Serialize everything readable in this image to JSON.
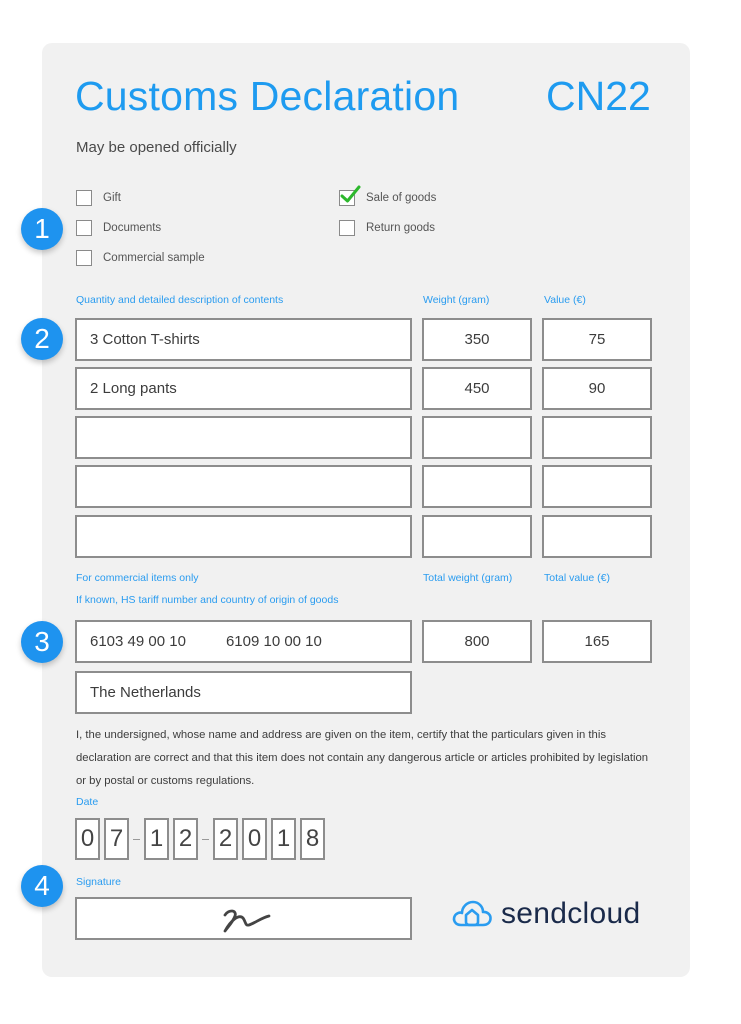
{
  "header": {
    "title": "Customs Declaration",
    "form_code": "CN22",
    "subtitle": "May be opened officially"
  },
  "badges": [
    "1",
    "2",
    "3",
    "4"
  ],
  "categories": {
    "left": [
      {
        "label": "Gift",
        "checked": false
      },
      {
        "label": "Documents",
        "checked": false
      },
      {
        "label": "Commercial sample",
        "checked": false
      }
    ],
    "right": [
      {
        "label": "Sale of goods",
        "checked": true
      },
      {
        "label": "Return goods",
        "checked": false
      }
    ]
  },
  "contents": {
    "headers": {
      "description": "Quantity and detailed description of contents",
      "weight": "Weight (gram)",
      "value": "Value (€)"
    },
    "rows": [
      {
        "description": "3 Cotton T-shirts",
        "weight": "350",
        "value": "75"
      },
      {
        "description": "2 Long pants",
        "weight": "450",
        "value": "90"
      },
      {
        "description": "",
        "weight": "",
        "value": ""
      },
      {
        "description": "",
        "weight": "",
        "value": ""
      },
      {
        "description": "",
        "weight": "",
        "value": ""
      }
    ]
  },
  "commercial": {
    "label_line1": "For commercial items only",
    "label_line2": "If known, HS tariff number and country of origin of goods",
    "total_weight_label": "Total weight (gram)",
    "total_value_label": "Total value (€)",
    "hs_code_1": "6103 49 00 10",
    "hs_code_2": "6109 10 00 10",
    "total_weight": "800",
    "total_value": "165",
    "country_of_origin": "The Netherlands"
  },
  "declaration": "I, the undersigned, whose name and address are given on the item, certify that the particulars given in this declaration are correct and that this item does not contain any dangerous article or articles prohibited by legislation or by postal or customs regulations.",
  "date": {
    "label": "Date",
    "day": [
      "0",
      "7"
    ],
    "month": [
      "1",
      "2"
    ],
    "year": [
      "2",
      "0",
      "1",
      "8"
    ],
    "separator": "-"
  },
  "signature": {
    "label": "Signature"
  },
  "brand": {
    "name": "sendcloud",
    "accent_color": "#1e9bf0",
    "check_color": "#2db82d"
  }
}
